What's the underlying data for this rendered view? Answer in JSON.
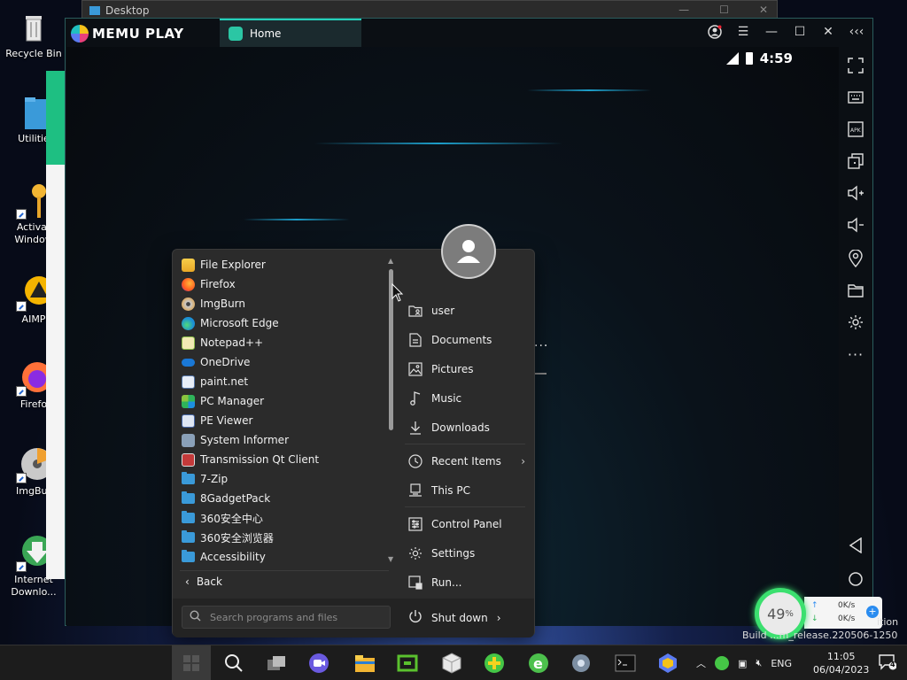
{
  "desktop": {
    "icons": [
      {
        "label": "Recycle Bin"
      },
      {
        "label": "Utilitie"
      },
      {
        "label": "Activat Window"
      },
      {
        "label": "AIMP"
      },
      {
        "label": "Firefo"
      },
      {
        "label": "ImgBur"
      },
      {
        "label": "Internet Downlo..."
      }
    ]
  },
  "background_window": {
    "title": "Desktop"
  },
  "memu": {
    "brand": "MEMU PLAY",
    "tab_label": "Home",
    "status_time": "4:59"
  },
  "start_menu": {
    "programs": [
      {
        "label": "File Explorer"
      },
      {
        "label": "Firefox"
      },
      {
        "label": "ImgBurn"
      },
      {
        "label": "Microsoft Edge"
      },
      {
        "label": "Notepad++"
      },
      {
        "label": "OneDrive"
      },
      {
        "label": "paint.net"
      },
      {
        "label": "PC Manager"
      },
      {
        "label": "PE Viewer"
      },
      {
        "label": "System Informer"
      },
      {
        "label": "Transmission Qt Client"
      },
      {
        "label": "7-Zip"
      },
      {
        "label": "8GadgetPack"
      },
      {
        "label": "360安全中心"
      },
      {
        "label": "360安全浏览器"
      },
      {
        "label": "Accessibility"
      }
    ],
    "back_label": "Back",
    "search_placeholder": "Search programs and files",
    "places": [
      {
        "label": "user"
      },
      {
        "label": "Documents"
      },
      {
        "label": "Pictures"
      },
      {
        "label": "Music"
      },
      {
        "label": "Downloads"
      },
      {
        "label": "Recent Items"
      },
      {
        "label": "This PC"
      },
      {
        "label": "Control Panel"
      },
      {
        "label": "Settings"
      },
      {
        "label": "Run..."
      }
    ],
    "shutdown_label": "Shut down"
  },
  "net_widget": {
    "percent": "49",
    "percent_sign": "%",
    "up_arrow": "↑",
    "down_arrow": "↓",
    "up_speed": "0K/s",
    "down_speed": "0K/s"
  },
  "watermark": {
    "edition": "ition",
    "build": "Build ...m_release.220506-1250"
  },
  "taskbar": {
    "language": "ENG",
    "time": "11:05",
    "date": "06/04/2023",
    "notification_count": "4"
  },
  "colors": {
    "accent_teal": "#25d0b9",
    "folder_blue": "#3a9ad9",
    "net_green": "#3be06f"
  }
}
